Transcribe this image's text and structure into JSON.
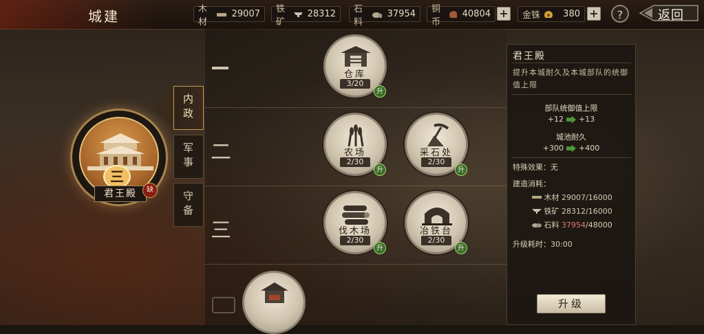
{
  "header": {
    "title": "城建",
    "resources": [
      {
        "label": "木材",
        "value": "29007",
        "icon": "wood-icon"
      },
      {
        "label": "铁矿",
        "value": "28312",
        "icon": "iron-icon"
      },
      {
        "label": "石料",
        "value": "37954",
        "icon": "stone-icon"
      },
      {
        "label": "铜币",
        "value": "40804",
        "icon": "copper-coin-icon"
      },
      {
        "label": "金铢",
        "value": "380",
        "icon": "gold-coin-icon"
      }
    ],
    "help_label": "?",
    "back_label": "返回"
  },
  "main_hall": {
    "name": "君王殿",
    "level": "三",
    "badge": "缺"
  },
  "tabs": [
    {
      "label": "内政",
      "active": true
    },
    {
      "label": "军事",
      "active": false
    },
    {
      "label": "守备",
      "active": false
    }
  ],
  "tiers": [
    "一",
    "二",
    "三"
  ],
  "buildings": [
    {
      "name": "仓库",
      "level": "3/20",
      "upgrade": "升",
      "icon": "warehouse-icon"
    },
    {
      "name": "农场",
      "level": "2/30",
      "upgrade": "升",
      "icon": "wheat-icon"
    },
    {
      "name": "采石处",
      "level": "2/30",
      "upgrade": "升",
      "icon": "pickaxe-icon"
    },
    {
      "name": "伐木场",
      "level": "2/30",
      "upgrade": "升",
      "icon": "logs-icon"
    },
    {
      "name": "冶铁台",
      "level": "2/30",
      "upgrade": "升",
      "icon": "furnace-icon"
    }
  ],
  "detail": {
    "title": "君王殿",
    "description": "提升本城耐久及本城部队的统御值上限",
    "stat1_label": "部队统御值上限",
    "stat1_from": "+12",
    "stat1_to": "+13",
    "stat2_label": "城池耐久",
    "stat2_from": "+300",
    "stat2_to": "+400",
    "special": "特殊效果：无",
    "cost_title": "建造消耗：",
    "costs": [
      {
        "label": "木材",
        "have": "29007",
        "need": "/16000",
        "enough": true
      },
      {
        "label": "铁矿",
        "have": "28312",
        "need": "/16000",
        "enough": true
      },
      {
        "label": "石料",
        "have": "37954",
        "need": "/48000",
        "enough": false
      }
    ],
    "time": "升级耗时：30:00",
    "button": "升级"
  },
  "colors": {
    "upgrade_badge": "#3c6c2a",
    "insufficient": "#e07a6a",
    "accent": "#c99a52"
  }
}
